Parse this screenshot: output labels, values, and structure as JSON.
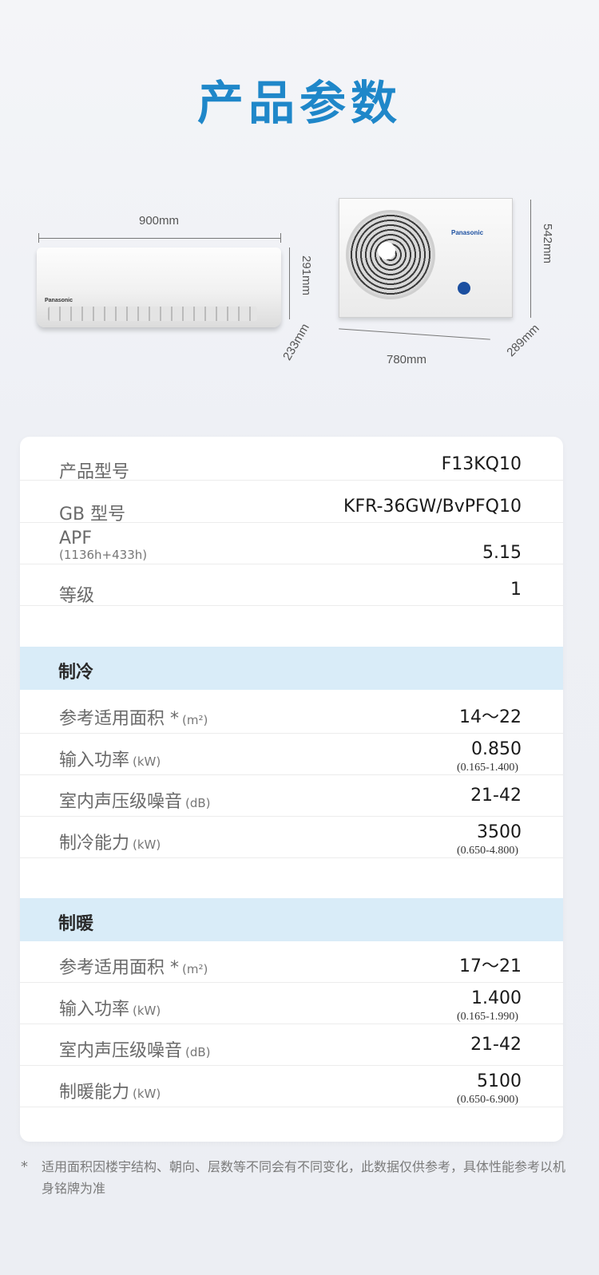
{
  "title": "产品参数",
  "dimensions": {
    "indoor_width": "900mm",
    "indoor_height": "291mm",
    "indoor_depth": "233mm",
    "outdoor_width": "780mm",
    "outdoor_height": "542mm",
    "outdoor_depth": "289mm",
    "brand": "Panasonic"
  },
  "basic": {
    "model_label": "产品型号",
    "model_value": "F13KQ10",
    "gb_label": "GB 型号",
    "gb_value": "KFR-36GW/BvPFQ10",
    "apf_label": "APF",
    "apf_sub": "(1136h+433h)",
    "apf_value": "5.15",
    "grade_label": "等级",
    "grade_value": "1"
  },
  "cooling": {
    "section_title": "制冷",
    "rows": [
      {
        "label": "参考适用面积 *",
        "unit": "(m²)",
        "value": "14～22",
        "sub": ""
      },
      {
        "label": "输入功率",
        "unit": "(kW)",
        "value": "0.850",
        "sub": "(0.165-1.400)"
      },
      {
        "label": "室内声压级噪音",
        "unit": "(dB)",
        "value": "21-42",
        "sub": ""
      },
      {
        "label": "制冷能力",
        "unit": "(kW)",
        "value": "3500",
        "sub": "(0.650-4.800)"
      }
    ]
  },
  "heating": {
    "section_title": "制暖",
    "rows": [
      {
        "label": "参考适用面积 *",
        "unit": "(m²)",
        "value": "17～21",
        "sub": ""
      },
      {
        "label": "输入功率",
        "unit": "(kW)",
        "value": "1.400",
        "sub": "(0.165-1.990)"
      },
      {
        "label": "室内声压级噪音",
        "unit": "(dB)",
        "value": "21-42",
        "sub": ""
      },
      {
        "label": "制暖能力",
        "unit": "(kW)",
        "value": "5100",
        "sub": "(0.650-6.900)"
      }
    ]
  },
  "footnote": {
    "star": "*",
    "text": "适用面积因楼宇结构、朝向、层数等不同会有不同变化，此数据仅供参考，具体性能参考以机身铭牌为准"
  }
}
